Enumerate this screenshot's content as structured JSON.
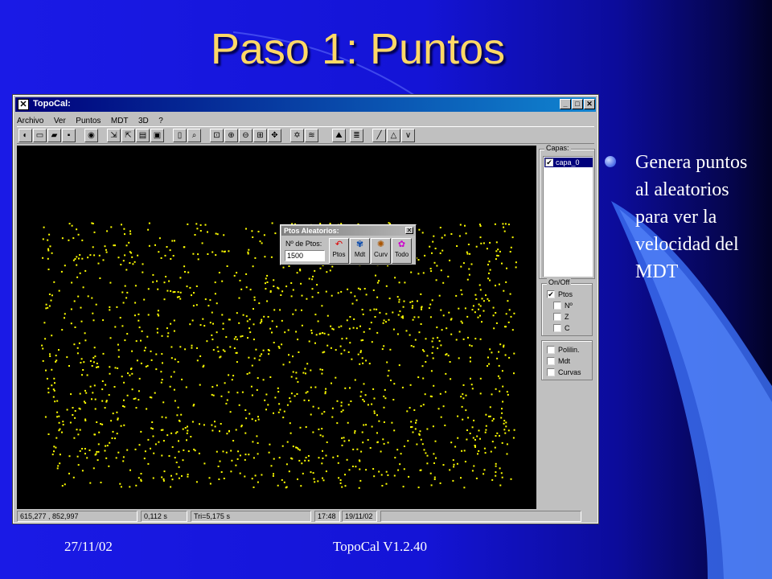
{
  "slide": {
    "title": "Paso 1: Puntos",
    "bullet": "Genera puntos al aleatorios para ver la velocidad del MDT",
    "footer_date": "27/11/02",
    "footer_center": "TopoCal V1.2.40"
  },
  "app": {
    "title": "TopoCal:",
    "icon": "topocal-app-icon",
    "menu": [
      "Archivo",
      "Ver",
      "Puntos",
      "MDT",
      "3D",
      "?"
    ],
    "window_buttons": [
      "minimize",
      "maximize",
      "close"
    ]
  },
  "dialog": {
    "title": "Ptos Aleatorios:",
    "label": "Nº de Ptos:",
    "value": "1500",
    "buttons": [
      "Ptos",
      "Mdt",
      "Curv",
      "Todo"
    ]
  },
  "layers": {
    "label": "Capas:",
    "items": [
      {
        "name": "capa_0",
        "checked": true
      }
    ]
  },
  "onoff": {
    "label": "On/Off",
    "items": [
      {
        "name": "Ptos",
        "checked": true
      },
      {
        "name": "Nº",
        "checked": false
      },
      {
        "name": "Z",
        "checked": false
      },
      {
        "name": "C",
        "checked": false
      }
    ]
  },
  "extra": {
    "items": [
      {
        "name": "Polilin.",
        "checked": false
      },
      {
        "name": "Mdt",
        "checked": false
      },
      {
        "name": "Curvas",
        "checked": false
      }
    ]
  },
  "status": {
    "coords": "615,277 , 852,997",
    "time1": "0,112 s",
    "tri": "Tri=5,175 s",
    "clock": "17:48",
    "date": "19/11/02"
  },
  "colors": {
    "title_text": "#ffd866",
    "points": "#ffff00",
    "canvas": "#000000",
    "slide_bg": "#1a1ae6"
  },
  "scatter": {
    "count": 1500
  }
}
